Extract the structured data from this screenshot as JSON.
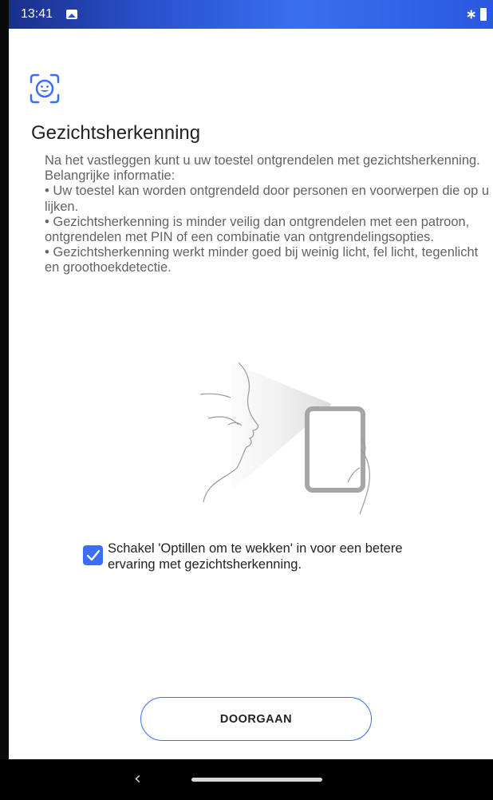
{
  "status_bar": {
    "time": "13:41",
    "icons": [
      "image-icon",
      "bluetooth-icon",
      "battery-icon"
    ]
  },
  "page": {
    "title": "Gezichtsherkenning",
    "icon": "face-recognition-icon",
    "description": [
      "Na het vastleggen kunt u uw toestel ontgrendelen met gezichtsherkenning. Belangrijke informatie:",
      "• Uw toestel kan worden ontgrendeld door personen en voorwerpen die op u lijken.",
      "• Gezichtsherkenning is minder veilig dan ontgrendelen met een patroon, ontgrendelen met PIN of een combinatie van ontgrendelingsopties.",
      "• Gezichtsherkenning werkt minder goed bij weinig licht, fel licht, tegenlicht en groothoekdetectie."
    ]
  },
  "checkbox": {
    "label": "Schakel 'Optillen om te wekken' in voor een betere ervaring met gezichtsherkenning.",
    "checked": true
  },
  "continue_button": {
    "label": "DOORGAAN"
  },
  "colors": {
    "accent": "#3b6ef5",
    "text_primary": "#222222",
    "text_secondary": "#5f6368",
    "status_bar": "#2a52d0"
  }
}
